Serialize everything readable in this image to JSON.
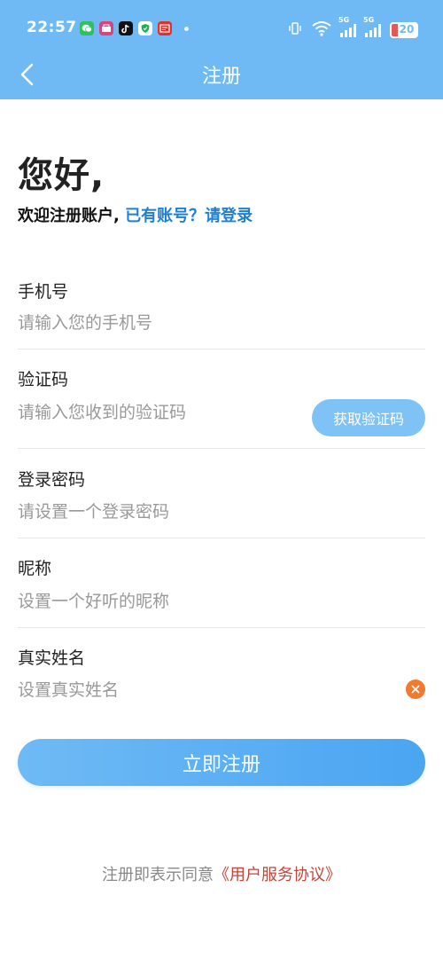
{
  "status_bar": {
    "time": "22:57",
    "apps": [
      "wechat-icon",
      "shopping-icon",
      "tiktok-icon",
      "shield-icon",
      "news-icon"
    ],
    "signal_tags": [
      "5G",
      "5G"
    ],
    "battery_level": "20"
  },
  "header": {
    "title": "注册"
  },
  "greeting": {
    "title": "您好,",
    "welcome_text": "欢迎注册账户,",
    "login_link": "已有账号？请登录"
  },
  "form": {
    "phone": {
      "label": "手机号",
      "placeholder": "请输入您的手机号",
      "value": ""
    },
    "code": {
      "label": "验证码",
      "placeholder": "请输入您收到的验证码",
      "value": "",
      "button": "获取验证码"
    },
    "password": {
      "label": "登录密码",
      "placeholder": "请设置一个登录密码",
      "value": ""
    },
    "nickname": {
      "label": "昵称",
      "placeholder": "设置一个好听的昵称",
      "value": ""
    },
    "realname": {
      "label": "真实姓名",
      "placeholder": "设置真实姓名",
      "value": ""
    }
  },
  "register_button": "立即注册",
  "agreement": {
    "prefix": "注册即表示同意",
    "link": "《用户服务协议》"
  },
  "colors": {
    "primary": "#6fbaf5",
    "link": "#1e7fd6",
    "agreement_link": "#c4443a",
    "clear": "#f07a2e"
  }
}
